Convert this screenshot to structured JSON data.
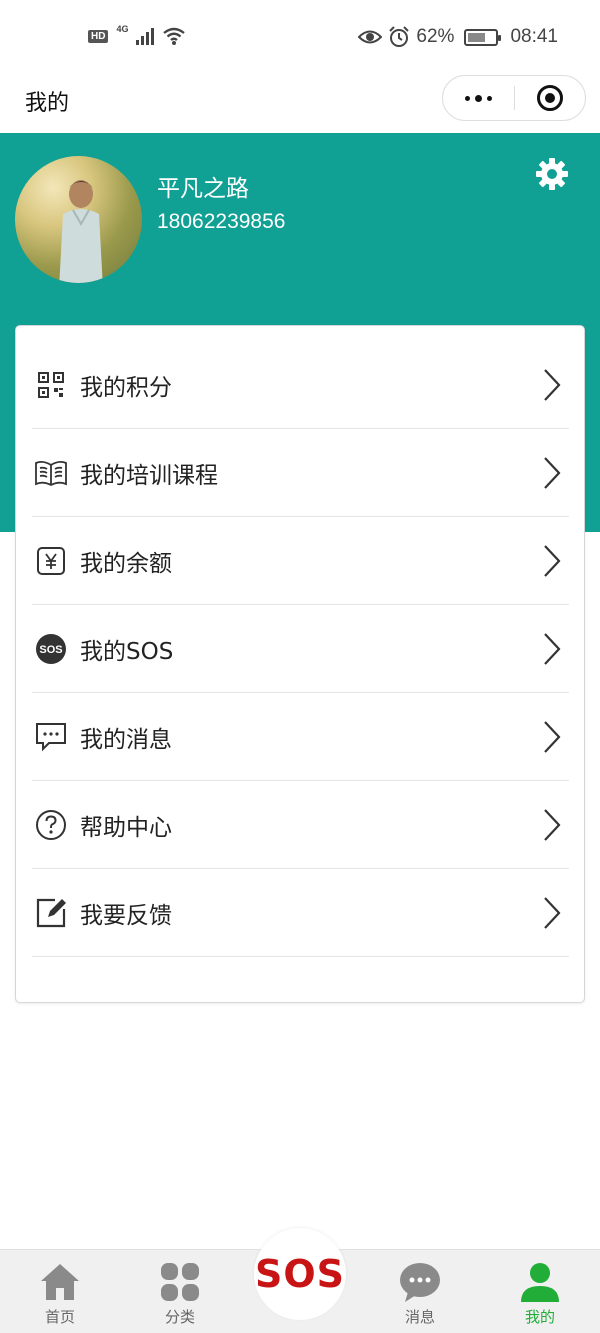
{
  "status_bar": {
    "hd": "HD",
    "network": "4G",
    "battery_percent": "62%",
    "battery_level": 0.62,
    "time": "08:41"
  },
  "navbar": {
    "title": "我的"
  },
  "profile": {
    "username": "平凡之路",
    "phone": "18062239856"
  },
  "menu": {
    "items": [
      {
        "label": "我的积分",
        "icon": "qr-code-icon"
      },
      {
        "label": "我的培训课程",
        "icon": "book-icon"
      },
      {
        "label": "我的余额",
        "icon": "yuan-icon"
      },
      {
        "label": "我的SOS",
        "icon": "sos-icon"
      },
      {
        "label": "我的消息",
        "icon": "message-icon"
      },
      {
        "label": "帮助中心",
        "icon": "help-icon"
      },
      {
        "label": "我要反馈",
        "icon": "feedback-icon"
      }
    ]
  },
  "sos_icon_text": "SOS",
  "tabbar": {
    "tabs": [
      {
        "label": "首页",
        "icon": "home-icon"
      },
      {
        "label": "分类",
        "icon": "grid-icon"
      },
      {
        "label": "消息",
        "icon": "chat-icon"
      },
      {
        "label": "我的",
        "icon": "person-icon",
        "active": true
      }
    ],
    "sos_label": "SOS"
  },
  "colors": {
    "header_bg": "#11a094",
    "active_tab": "#22ad38",
    "sos_red": "#c81414"
  }
}
